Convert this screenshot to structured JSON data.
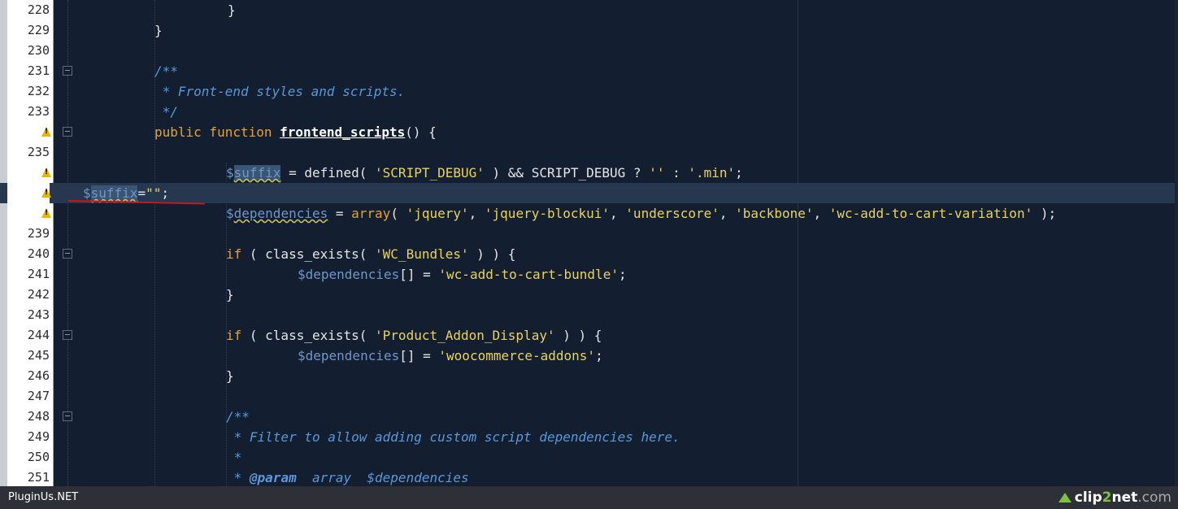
{
  "editor": {
    "rows": [
      {
        "ln": "228",
        "warn": false,
        "fold": false,
        "indent": 280,
        "tokens": [
          {
            "t": "}",
            "c": "plain"
          }
        ]
      },
      {
        "ln": "229",
        "warn": false,
        "fold": false,
        "indent": 190,
        "tokens": [
          {
            "t": "}",
            "c": "plain"
          }
        ]
      },
      {
        "ln": "230",
        "warn": false,
        "fold": false,
        "indent": 190,
        "tokens": []
      },
      {
        "ln": "231",
        "warn": false,
        "fold": true,
        "indent": 190,
        "tokens": [
          {
            "t": "/**",
            "c": "cm"
          }
        ]
      },
      {
        "ln": "232",
        "warn": false,
        "fold": false,
        "indent": 190,
        "tokens": [
          {
            "t": " * Front-end styles and scripts.",
            "c": "cm"
          }
        ]
      },
      {
        "ln": "233",
        "warn": false,
        "fold": false,
        "indent": 190,
        "tokens": [
          {
            "t": " */",
            "c": "cm"
          }
        ]
      },
      {
        "ln": "",
        "warn": true,
        "fold": true,
        "indent": 190,
        "tokens": [
          {
            "t": "public function ",
            "c": "kw"
          },
          {
            "t": "frontend_scripts",
            "c": "fn"
          },
          {
            "t": "() {",
            "c": "plain"
          }
        ]
      },
      {
        "ln": "235",
        "warn": false,
        "fold": false,
        "indent": 190,
        "tokens": []
      },
      {
        "ln": "",
        "warn": true,
        "fold": false,
        "indent": 278,
        "tokens": [
          {
            "t": "$",
            "c": "var"
          },
          {
            "t": "suffix",
            "c": "var hl uline"
          },
          {
            "t": " = defined( ",
            "c": "plain"
          },
          {
            "t": "'SCRIPT_DEBUG'",
            "c": "str"
          },
          {
            "t": " ) && SCRIPT_DEBUG ? ",
            "c": "plain"
          },
          {
            "t": "''",
            "c": "str"
          },
          {
            "t": " : ",
            "c": "plain"
          },
          {
            "t": "'.min'",
            "c": "str"
          },
          {
            "t": ";",
            "c": "plain"
          }
        ]
      },
      {
        "ln": "",
        "warn": true,
        "fold": false,
        "indent": 102,
        "current": true,
        "tokens": [
          {
            "t": "$",
            "c": "var"
          },
          {
            "t": "suffix",
            "c": "var hl uline"
          },
          {
            "t": "=",
            "c": "plain"
          },
          {
            "t": "\"\"",
            "c": "str"
          },
          {
            "t": ";",
            "c": "plain"
          }
        ]
      },
      {
        "ln": "",
        "warn": true,
        "fold": false,
        "indent": 278,
        "tokens": [
          {
            "t": "$",
            "c": "var"
          },
          {
            "t": "dependencies",
            "c": "var uline"
          },
          {
            "t": " = ",
            "c": "plain"
          },
          {
            "t": "array",
            "c": "kw"
          },
          {
            "t": "( ",
            "c": "plain"
          },
          {
            "t": "'jquery'",
            "c": "str"
          },
          {
            "t": ", ",
            "c": "plain"
          },
          {
            "t": "'jquery-blockui'",
            "c": "str"
          },
          {
            "t": ", ",
            "c": "plain"
          },
          {
            "t": "'underscore'",
            "c": "str"
          },
          {
            "t": ", ",
            "c": "plain"
          },
          {
            "t": "'backbone'",
            "c": "str"
          },
          {
            "t": ", ",
            "c": "plain"
          },
          {
            "t": "'wc-add-to-cart-variation'",
            "c": "str"
          },
          {
            "t": " );",
            "c": "plain"
          }
        ]
      },
      {
        "ln": "239",
        "warn": false,
        "fold": false,
        "indent": 278,
        "tokens": []
      },
      {
        "ln": "240",
        "warn": false,
        "fold": true,
        "indent": 278,
        "tokens": [
          {
            "t": "if",
            "c": "kw"
          },
          {
            "t": " ( class_exists( ",
            "c": "plain"
          },
          {
            "t": "'WC_Bundles'",
            "c": "str"
          },
          {
            "t": " ) ) {",
            "c": "plain"
          }
        ]
      },
      {
        "ln": "241",
        "warn": false,
        "fold": false,
        "indent": 366,
        "tokens": [
          {
            "t": "$dependencies",
            "c": "var"
          },
          {
            "t": "[] = ",
            "c": "plain"
          },
          {
            "t": "'wc-add-to-cart-bundle'",
            "c": "str"
          },
          {
            "t": ";",
            "c": "plain"
          }
        ]
      },
      {
        "ln": "242",
        "warn": false,
        "fold": false,
        "indent": 278,
        "tokens": [
          {
            "t": "}",
            "c": "plain"
          }
        ]
      },
      {
        "ln": "243",
        "warn": false,
        "fold": false,
        "indent": 278,
        "tokens": []
      },
      {
        "ln": "244",
        "warn": false,
        "fold": true,
        "indent": 278,
        "tokens": [
          {
            "t": "if",
            "c": "kw"
          },
          {
            "t": " ( class_exists( ",
            "c": "plain"
          },
          {
            "t": "'Product_Addon_Display'",
            "c": "str"
          },
          {
            "t": " ) ) {",
            "c": "plain"
          }
        ]
      },
      {
        "ln": "245",
        "warn": false,
        "fold": false,
        "indent": 366,
        "tokens": [
          {
            "t": "$dependencies",
            "c": "var"
          },
          {
            "t": "[] = ",
            "c": "plain"
          },
          {
            "t": "'woocommerce-addons'",
            "c": "str"
          },
          {
            "t": ";",
            "c": "plain"
          }
        ]
      },
      {
        "ln": "246",
        "warn": false,
        "fold": false,
        "indent": 278,
        "tokens": [
          {
            "t": "}",
            "c": "plain"
          }
        ]
      },
      {
        "ln": "247",
        "warn": false,
        "fold": false,
        "indent": 278,
        "tokens": []
      },
      {
        "ln": "248",
        "warn": false,
        "fold": true,
        "indent": 278,
        "tokens": [
          {
            "t": "/**",
            "c": "cm"
          }
        ]
      },
      {
        "ln": "249",
        "warn": false,
        "fold": false,
        "indent": 278,
        "tokens": [
          {
            "t": " * Filter to allow adding custom script dependencies here.",
            "c": "cm"
          }
        ]
      },
      {
        "ln": "250",
        "warn": false,
        "fold": false,
        "indent": 278,
        "tokens": [
          {
            "t": " *",
            "c": "cm"
          }
        ]
      },
      {
        "ln": "251",
        "warn": false,
        "fold": false,
        "indent": 278,
        "tokens": [
          {
            "t": " * ",
            "c": "cm"
          },
          {
            "t": "@param",
            "c": "cmb"
          },
          {
            "t": "  array  $dependencies",
            "c": "cm"
          }
        ]
      }
    ]
  },
  "status_bar": {
    "watermark": "PluginUs.NET",
    "logo_prefix": "clip",
    "logo_two": "2",
    "logo_net": "net",
    "logo_domain": ".com"
  }
}
